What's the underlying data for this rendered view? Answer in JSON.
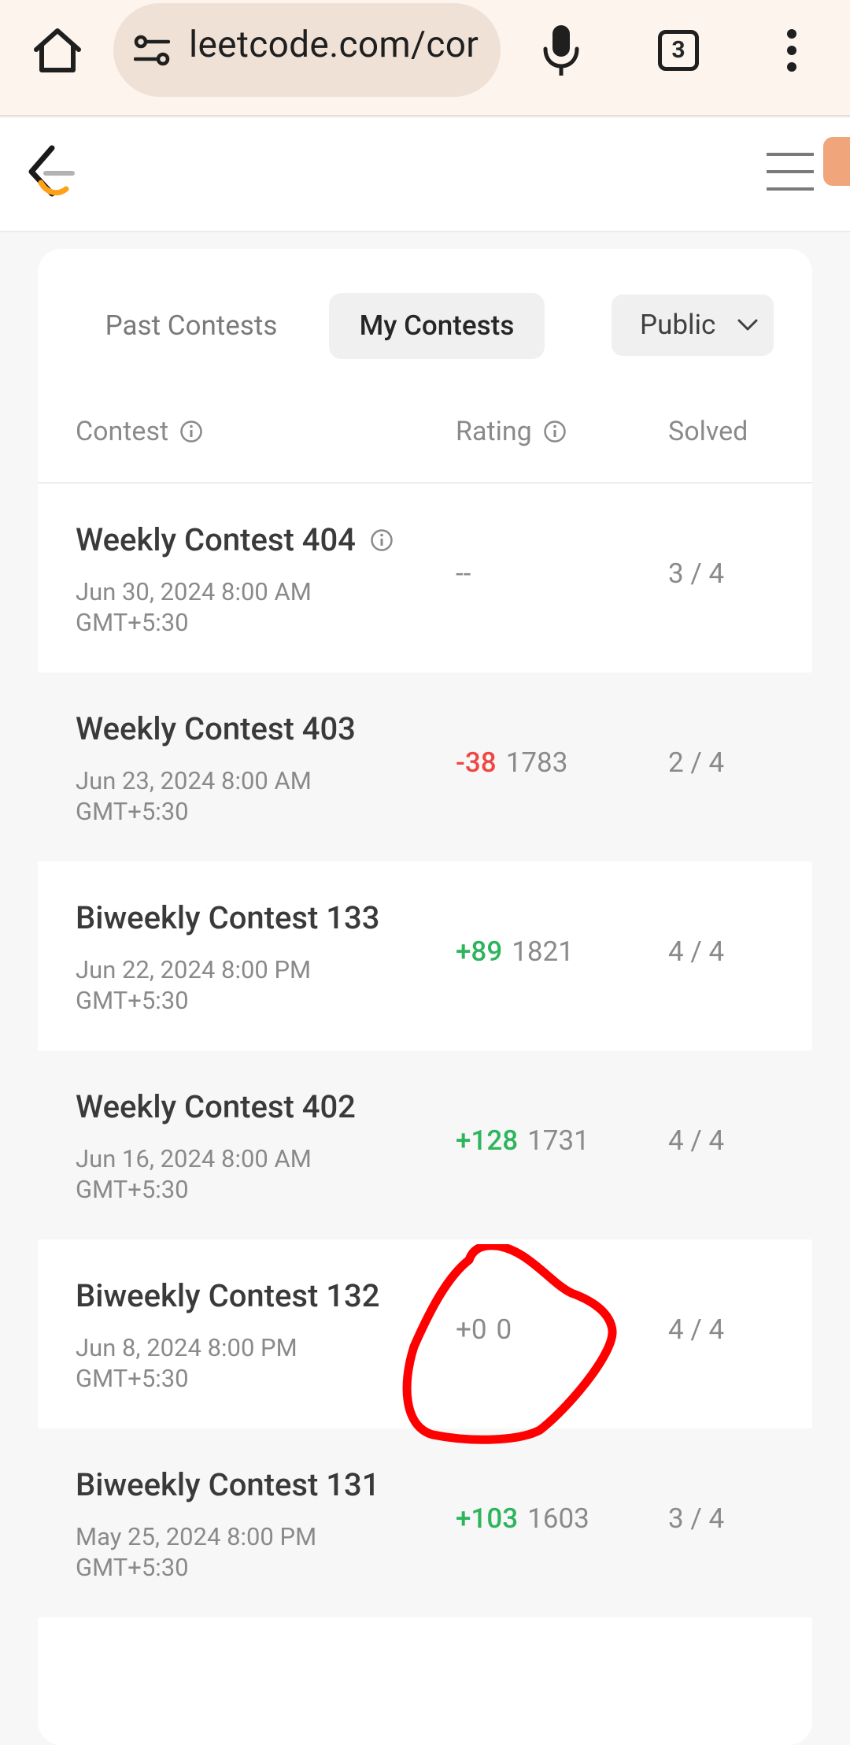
{
  "browser": {
    "url": "leetcode.com/cor",
    "tab_count": "3"
  },
  "tabs": {
    "past": "Past Contests",
    "mine": "My Contests",
    "visibility": "Public"
  },
  "table": {
    "headers": {
      "contest": "Contest",
      "rating": "Rating",
      "solved": "Solved"
    },
    "rows": [
      {
        "name": "Weekly Contest 404",
        "date_line1": "Jun 30, 2024 8:00 AM",
        "date_line2": "GMT+5:30",
        "delta": "--",
        "rating": "",
        "solved": "3 / 4"
      },
      {
        "name": "Weekly Contest 403",
        "date_line1": "Jun 23, 2024 8:00 AM",
        "date_line2": "GMT+5:30",
        "delta": "-38",
        "rating": "1783",
        "solved": "2 / 4"
      },
      {
        "name": "Biweekly Contest 133",
        "date_line1": "Jun 22, 2024 8:00 PM",
        "date_line2": "GMT+5:30",
        "delta": "+89",
        "rating": "1821",
        "solved": "4 / 4"
      },
      {
        "name": "Weekly Contest 402",
        "date_line1": "Jun 16, 2024 8:00 AM",
        "date_line2": "GMT+5:30",
        "delta": "+128",
        "rating": "1731",
        "solved": "4 / 4"
      },
      {
        "name": "Biweekly Contest 132",
        "date_line1": "Jun 8, 2024 8:00 PM",
        "date_line2": "GMT+5:30",
        "delta": "+0",
        "rating": "0",
        "solved": "4 / 4"
      },
      {
        "name": "Biweekly Contest 131",
        "date_line1": "May 25, 2024 8:00 PM",
        "date_line2": "GMT+5:30",
        "delta": "+103",
        "rating": "1603",
        "solved": "3 / 4"
      }
    ]
  },
  "colors": {
    "positive": "#2db55d",
    "negative": "#ef4743",
    "neutral": "#8a8a8a",
    "annotation": "#ff0000"
  },
  "icons": [
    "home-icon",
    "site-settings-icon",
    "mic-icon",
    "tab-switcher-icon",
    "more-vert-icon",
    "leetcode-logo",
    "hamburger-icon",
    "info-icon",
    "chevron-down-icon"
  ]
}
